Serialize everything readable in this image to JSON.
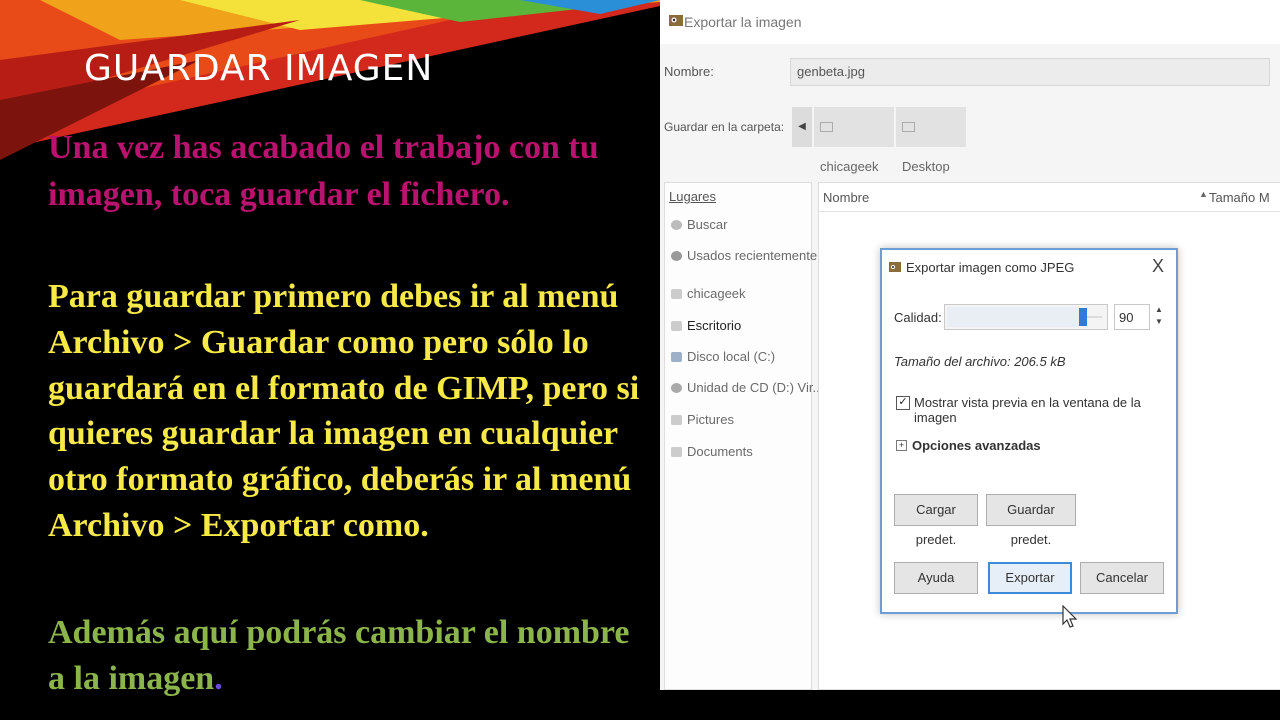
{
  "slide": {
    "title": "GUARDAR IMAGEN",
    "paragraph1": {
      "text": "Una vez has acabado el trabajo con tu imagen, toca ",
      "emphasis": "guardar el fichero",
      "end": "."
    },
    "paragraph2": "Para guardar primero debes ir al menú Archivo > Guardar como pero sólo lo guardará en el formato de GIMP, pero si quieres guardar la imagen en cualquier otro formato gráfico, deberás ir al menú Archivo > Exportar como.",
    "paragraph3": {
      "text": "Además aquí podrás cambiar el nombre a la imagen",
      "end": "."
    },
    "colors": {
      "background": "#000000",
      "title": "#ffffff",
      "paragraph1": "#b9136f",
      "paragraph2": "#f7e948",
      "paragraph3": "#8bb44a",
      "period_accent": "#6a4bd8"
    }
  },
  "export_window": {
    "title": "Exportar la imagen",
    "name_label": "Nombre:",
    "name_value": "genbeta.jpg",
    "folder_label": "Guardar en la carpeta:",
    "breadcrumbs": [
      "chicageek",
      "Desktop"
    ],
    "places_header": "Lugares",
    "places": [
      {
        "label": "Buscar",
        "icon": "search-icon"
      },
      {
        "label": "Usados recientemente",
        "icon": "recent-icon"
      },
      {
        "label": "chicageek",
        "icon": "folder-icon"
      },
      {
        "label": "Escritorio",
        "icon": "folder-icon"
      },
      {
        "label": "Disco local (C:)",
        "icon": "drive-icon"
      },
      {
        "label": "Unidad de CD (D:) Vir...",
        "icon": "cd-icon"
      },
      {
        "label": "Pictures",
        "icon": "folder-icon"
      },
      {
        "label": "Documents",
        "icon": "folder-icon"
      }
    ],
    "columns": {
      "name": "Nombre",
      "size": "Tamaño M"
    }
  },
  "jpeg_dialog": {
    "title": "Exportar imagen como JPEG",
    "close": "X",
    "quality_label": "Calidad:",
    "quality_value": "90",
    "quality_max": 100,
    "file_size": "Tamaño del archivo: 206.5 kB",
    "preview_checkbox_label": "Mostrar vista previa en la ventana de la imagen",
    "preview_checked": true,
    "advanced_label": "Opciones avanzadas",
    "load_defaults": "Cargar predet.",
    "save_defaults": "Guardar predet.",
    "help": "Ayuda",
    "export": "Exportar",
    "cancel": "Cancelar"
  }
}
